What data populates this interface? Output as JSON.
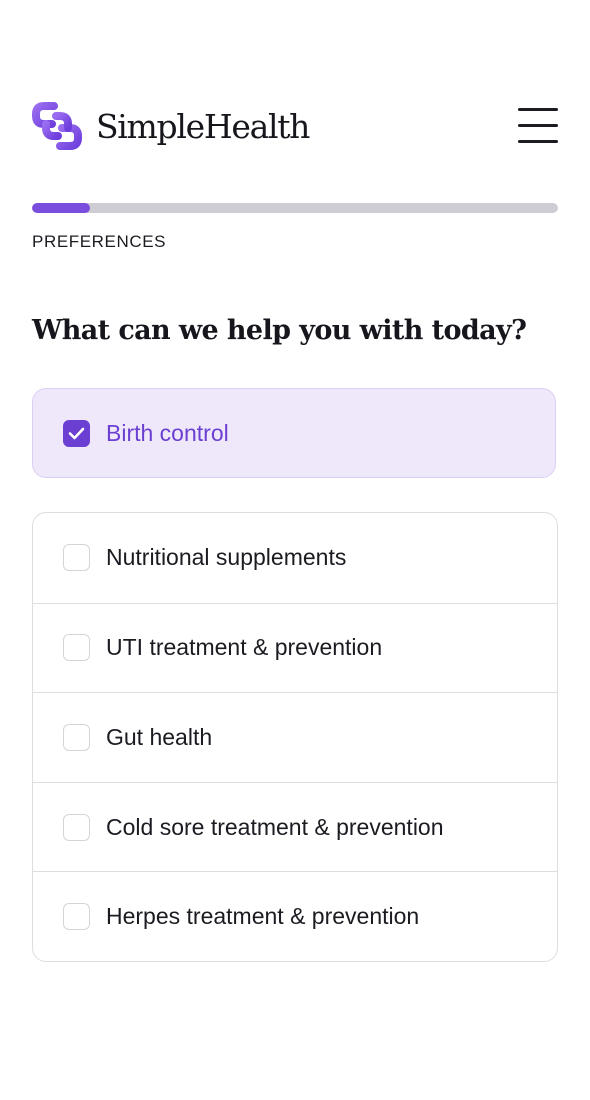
{
  "header": {
    "brand": "SimpleHealth",
    "logo_icon": "link-logo-icon",
    "menu_icon": "hamburger-menu-icon",
    "brand_color": "#7b4ddf"
  },
  "progress": {
    "fraction": 0.11,
    "step_label": "PREFERENCES"
  },
  "question": "What can we help you with today?",
  "options": [
    {
      "label": "Birth control",
      "checked": true
    },
    {
      "label": "Nutritional supplements",
      "checked": false
    },
    {
      "label": "UTI treatment & prevention",
      "checked": false
    },
    {
      "label": "Gut health",
      "checked": false
    },
    {
      "label": "Cold sore treatment & prevention",
      "checked": false
    },
    {
      "label": "Herpes treatment & prevention",
      "checked": false
    }
  ]
}
